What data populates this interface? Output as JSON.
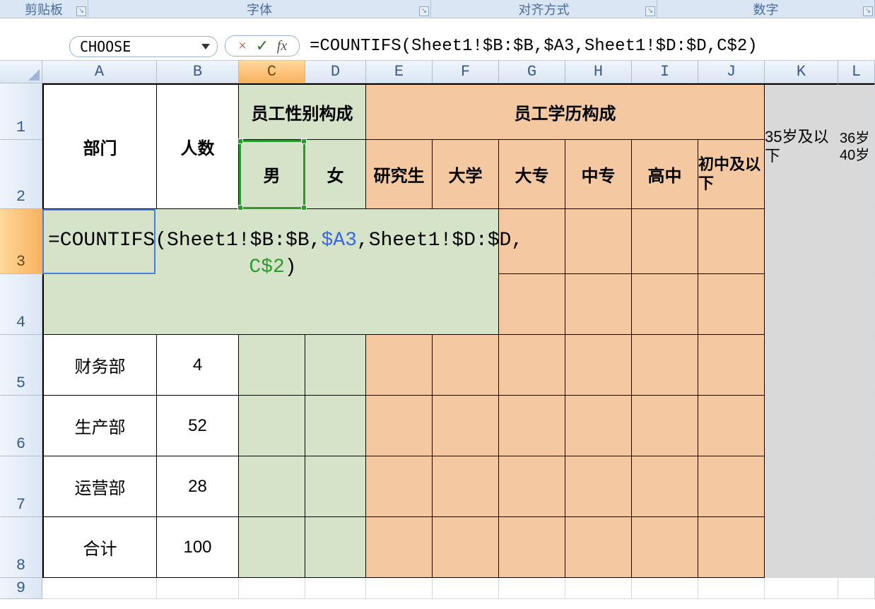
{
  "ribbon": {
    "groups": [
      {
        "label": "剪贴板"
      },
      {
        "label": "字体"
      },
      {
        "label": "对齐方式"
      },
      {
        "label": "数字"
      }
    ]
  },
  "formula_bar": {
    "name_box": "CHOOSE",
    "cancel_icon": "×",
    "enter_icon": "✓",
    "fx_icon": "fx",
    "formula": "=COUNTIFS(Sheet1!$B:$B,$A3,Sheet1!$D:$D,C$2)"
  },
  "columns": [
    "A",
    "B",
    "C",
    "D",
    "E",
    "F",
    "G",
    "H",
    "I",
    "J",
    "K",
    "L"
  ],
  "headers": {
    "dept": "部门",
    "count": "人数",
    "gender_composition": "员工性别构成",
    "education_composition": "员工学历构成",
    "male": "男",
    "female": "女",
    "postgrad": "研究生",
    "university": "大学",
    "college": "大专",
    "secondary_tech": "中专",
    "highschool": "高中",
    "junior_below": "初中及以下",
    "age_35_below": "35岁及以下",
    "age_36_40": "36岁40岁"
  },
  "formula_cell": {
    "p1": "=COUNTIFS(Sheet1!$B:$B,",
    "p2": "$A3",
    "p3": ",Sheet1!$D:$D,",
    "p4": "C$2",
    "p5": ")"
  },
  "data_rows": [
    {
      "dept": "财务部",
      "count": "4"
    },
    {
      "dept": "生产部",
      "count": "52"
    },
    {
      "dept": "运营部",
      "count": "28"
    },
    {
      "dept": "合计",
      "count": "100"
    }
  ],
  "row_numbers": [
    "1",
    "2",
    "3",
    "4",
    "5",
    "6",
    "7",
    "8",
    "9"
  ]
}
